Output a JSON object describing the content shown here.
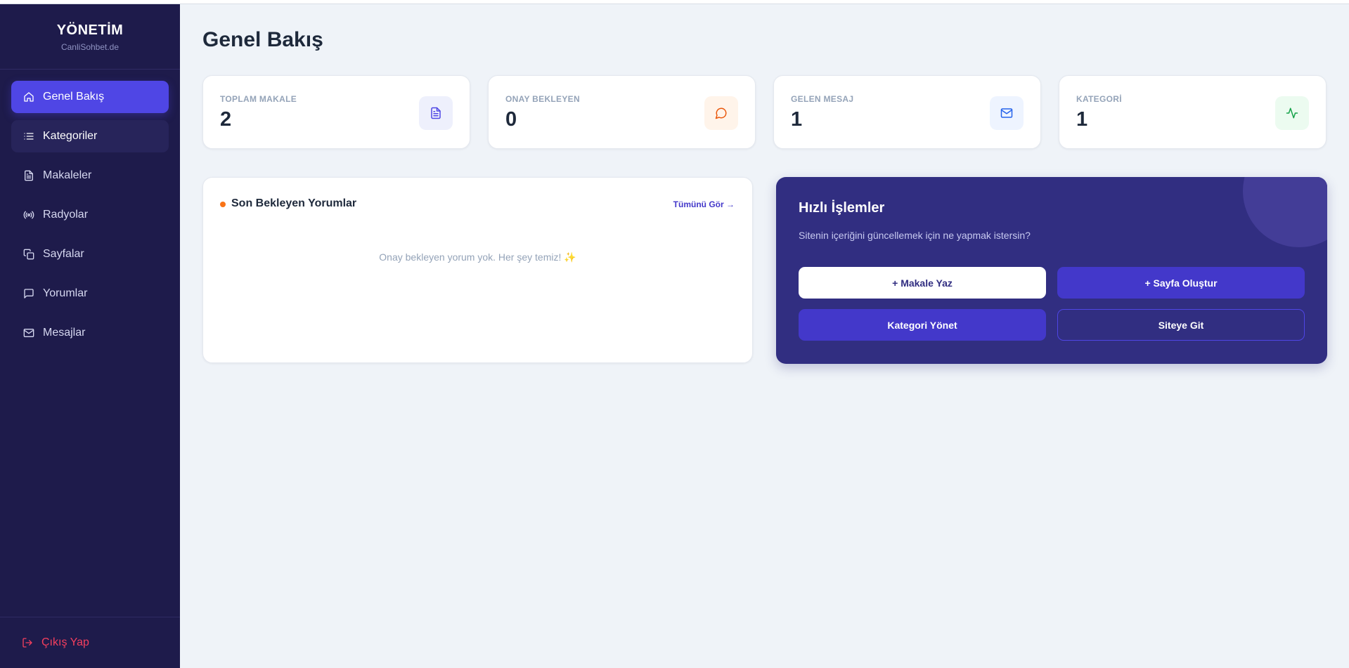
{
  "brand": {
    "title": "YÖNETİM",
    "subtitle": "CanliSohbet.de"
  },
  "nav": [
    {
      "label": "Genel Bakış",
      "icon": "home-icon"
    },
    {
      "label": "Kategoriler",
      "icon": "list-icon"
    },
    {
      "label": "Makaleler",
      "icon": "file-text-icon"
    },
    {
      "label": "Radyolar",
      "icon": "radio-icon"
    },
    {
      "label": "Sayfalar",
      "icon": "copy-icon"
    },
    {
      "label": "Yorumlar",
      "icon": "message-square-icon"
    },
    {
      "label": "Mesajlar",
      "icon": "mail-icon"
    }
  ],
  "logout": {
    "label": "Çıkış Yap",
    "icon": "log-out-icon"
  },
  "page": {
    "title": "Genel Bakış"
  },
  "stats": [
    {
      "label": "TOPLAM MAKALE",
      "value": "2",
      "icon": "file-text-icon",
      "color": "#4f46e5",
      "bg": "#eef0fc"
    },
    {
      "label": "ONAY BEKLEYEN",
      "value": "0",
      "icon": "message-circle-icon",
      "color": "#ea580c",
      "bg": "#fff4ea"
    },
    {
      "label": "GELEN MESAJ",
      "value": "1",
      "icon": "mail-icon",
      "color": "#2563eb",
      "bg": "#eef4ff"
    },
    {
      "label": "KATEGORİ",
      "value": "1",
      "icon": "activity-icon",
      "color": "#16a34a",
      "bg": "#ecfbf0"
    }
  ],
  "pending": {
    "title": "Son Bekleyen Yorumlar",
    "link": "Tümünü Gör →",
    "empty": "Onay bekleyen yorum yok. Her şey temiz! ✨"
  },
  "quick": {
    "title": "Hızlı İşlemler",
    "subtitle": "Sitenin içeriğini güncellemek için ne yapmak istersin?",
    "buttons": {
      "write_article": "+ Makale Yaz",
      "create_page": "+ Sayfa Oluştur",
      "manage_categories": "Kategori Yönet",
      "go_to_site": "Siteye Git"
    }
  },
  "colors": {
    "sidebar": "#1e1b4b",
    "accent": "#4f46e5",
    "quick_panel": "#312e81",
    "danger": "#f43f5e"
  }
}
